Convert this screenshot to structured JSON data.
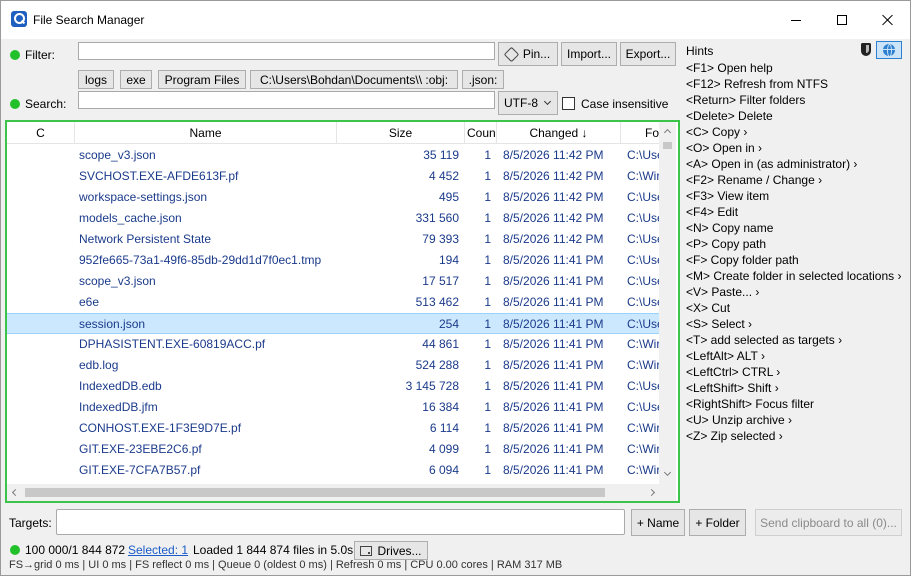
{
  "window": {
    "title": "File Search Manager",
    "controls": {
      "minimize": "minimize",
      "maximize": "maximize",
      "close": "close"
    }
  },
  "filter": {
    "label": "Filter:",
    "value": "",
    "pin_label": "Pin...",
    "import_label": "Import...",
    "export_label": "Export...",
    "chips": [
      "logs",
      "exe",
      "Program Files",
      "C:\\Users\\Bohdan\\Documents\\\\ :obj:",
      ".json:"
    ]
  },
  "search": {
    "label": "Search:",
    "value": "",
    "encoding": "UTF-8",
    "case_label": "Case insensitive",
    "case_checked": false
  },
  "columns": {
    "c": "C",
    "name": "Name",
    "size": "Size",
    "count": "Count",
    "changed": "Changed",
    "changed_sort_icon": "↓",
    "folder": "Folder"
  },
  "rows": [
    {
      "name": "scope_v3.json",
      "size": "35 119",
      "count": "1",
      "changed": "8/5/2026 11:42 PM",
      "folder": "C:\\Use"
    },
    {
      "name": "SVCHOST.EXE-AFDE613F.pf",
      "size": "4 452",
      "count": "1",
      "changed": "8/5/2026 11:42 PM",
      "folder": "C:\\Wir"
    },
    {
      "name": "workspace-settings.json",
      "size": "495",
      "count": "1",
      "changed": "8/5/2026 11:42 PM",
      "folder": "C:\\Use"
    },
    {
      "name": "models_cache.json",
      "size": "331 560",
      "count": "1",
      "changed": "8/5/2026 11:42 PM",
      "folder": "C:\\Use"
    },
    {
      "name": "Network Persistent State",
      "size": "79 393",
      "count": "1",
      "changed": "8/5/2026 11:42 PM",
      "folder": "C:\\Use"
    },
    {
      "name": "952fe665-73a1-49f6-85db-29dd1d7f0ec1.tmp",
      "size": "194",
      "count": "1",
      "changed": "8/5/2026 11:41 PM",
      "folder": "C:\\Use"
    },
    {
      "name": "scope_v3.json",
      "size": "17 517",
      "count": "1",
      "changed": "8/5/2026 11:41 PM",
      "folder": "C:\\Use"
    },
    {
      "name": "e6e",
      "size": "513 462",
      "count": "1",
      "changed": "8/5/2026 11:41 PM",
      "folder": "C:\\Use"
    },
    {
      "name": "session.json",
      "size": "254",
      "count": "1",
      "changed": "8/5/2026 11:41 PM",
      "folder": "C:\\Use",
      "selected": true
    },
    {
      "name": "DPHASISTENT.EXE-60819ACC.pf",
      "size": "44 861",
      "count": "1",
      "changed": "8/5/2026 11:41 PM",
      "folder": "C:\\Wir"
    },
    {
      "name": "edb.log",
      "size": "524 288",
      "count": "1",
      "changed": "8/5/2026 11:41 PM",
      "folder": "C:\\Wir"
    },
    {
      "name": "IndexedDB.edb",
      "size": "3 145 728",
      "count": "1",
      "changed": "8/5/2026 11:41 PM",
      "folder": "C:\\Use"
    },
    {
      "name": "IndexedDB.jfm",
      "size": "16 384",
      "count": "1",
      "changed": "8/5/2026 11:41 PM",
      "folder": "C:\\Use"
    },
    {
      "name": "CONHOST.EXE-1F3E9D7E.pf",
      "size": "6 114",
      "count": "1",
      "changed": "8/5/2026 11:41 PM",
      "folder": "C:\\Wir"
    },
    {
      "name": "GIT.EXE-23EBE2C6.pf",
      "size": "4 099",
      "count": "1",
      "changed": "8/5/2026 11:41 PM",
      "folder": "C:\\Wir"
    },
    {
      "name": "GIT.EXE-7CFA7B57.pf",
      "size": "6 094",
      "count": "1",
      "changed": "8/5/2026 11:41 PM",
      "folder": "C:\\Wir"
    }
  ],
  "hints": {
    "title": "Hints",
    "items": [
      "<F1> Open help",
      "<F12> Refresh from NTFS",
      "<Return> Filter folders",
      "<Delete> Delete",
      "<C> Copy ›",
      "<O> Open in ›",
      "<A> Open in (as administrator) ›",
      "<F2> Rename / Change ›",
      "<F3> View item",
      "<F4> Edit",
      "<N> Copy name",
      "<P> Copy path",
      "<F> Copy folder path",
      "<M> Create folder in selected locations ›",
      "<V> Paste... ›",
      "<X> Cut",
      "<S> Select ›",
      "<T> add selected as targets ›",
      "<LeftAlt> ALT ›",
      "<LeftCtrl> CTRL ›",
      "<LeftShift> Shift ›",
      "<RightShift> Focus filter",
      "<U> Unzip archive ›",
      "<Z> Zip selected ›"
    ],
    "shield_icon": "shield-icon",
    "globe_icon": "globe-icon"
  },
  "targets": {
    "label": "Targets:",
    "value": "",
    "add_name_label": "+ Name",
    "add_folder_label": "+ Folder",
    "send_clipboard_label": "Send clipboard to all (0)..."
  },
  "status": {
    "counts": "100 000/1 844 872",
    "selected": "Selected: 1",
    "loaded": "Loaded 1 844 874 files in 5.0s",
    "drives_label": "Drives..."
  },
  "metrics": "FS→grid 0 ms  |  UI 0 ms  |  FS reflect 0 ms  |  Queue 0 (oldest 0 ms)  |  Refresh 0 ms  |  CPU 0.00 cores  |  RAM 317 MB",
  "colors": {
    "accent_green": "#22c02a",
    "list_border": "#3cc34a",
    "selection": "#cce8ff",
    "link": "#1a5cc8"
  }
}
